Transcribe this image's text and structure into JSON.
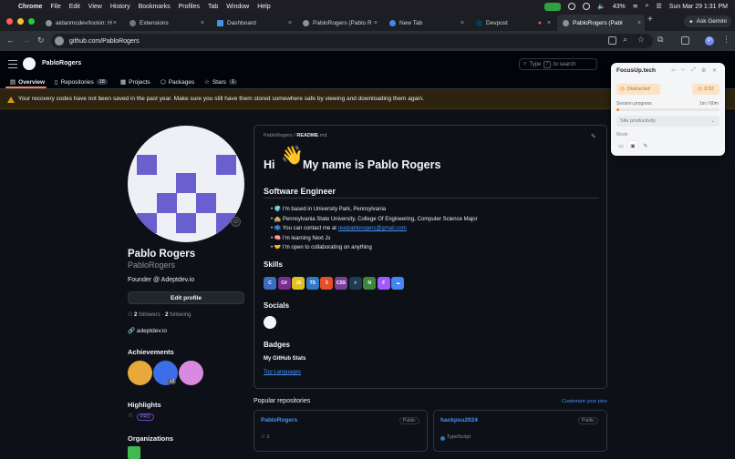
{
  "menubar": {
    "app": "Chrome",
    "items": [
      "File",
      "Edit",
      "View",
      "History",
      "Bookmarks",
      "Profiles",
      "Tab",
      "Window",
      "Help"
    ],
    "battery": "43%",
    "clock": "Sun Mar 29  1:31 PM"
  },
  "tabs": [
    {
      "label": "aidanmcdev/lockin: H"
    },
    {
      "label": "Extensions"
    },
    {
      "label": "Dashboard"
    },
    {
      "label": "PabloRogers (Pablo R"
    },
    {
      "label": "New Tab"
    },
    {
      "label": "Devpost"
    },
    {
      "label": "PabloRogers (Pabl"
    }
  ],
  "ask_gemini": "Ask Gemini",
  "address": {
    "url": "github.com/PabloRogers"
  },
  "gh": {
    "username": "PabloRogers",
    "search_text": "Type",
    "search_key": "/",
    "search_suffix": "to search",
    "nav": [
      {
        "label": "Overview"
      },
      {
        "label": "Repositories",
        "count": "18"
      },
      {
        "label": "Projects"
      },
      {
        "label": "Packages"
      },
      {
        "label": "Stars",
        "count": "1"
      }
    ]
  },
  "banner": {
    "text": "Your recovery codes have not been saved in the past year. Make sure you still have them stored somewhere safe by viewing and downloading them again."
  },
  "profile": {
    "name": "Pablo Rogers",
    "login": "PabloRogers",
    "bio": "Founder @ Adeptdev.io",
    "edit_label": "Edit profile",
    "followers": "2",
    "followers_label": "followers",
    "sep": "·",
    "following": "2",
    "following_label": "following",
    "website": "adeptdev.io",
    "achievements_label": "Achievements",
    "badge_count": "x2",
    "highlights_label": "Highlights",
    "pro_label": "PRO",
    "organizations_label": "Organizations"
  },
  "readme": {
    "path_user": "PabloRogers",
    "path_sep": " / ",
    "path_file": "README",
    "path_ext": ".md",
    "hi": "Hi",
    "heading": "My name is Pablo Rogers",
    "subheading": "Software Engineer",
    "bullets": [
      {
        "text": "🌍 I'm based in University Park, Pennsylvania"
      },
      {
        "text": "🏫 Pennsylvania State University, College Of Engineering, Computer Science Major"
      },
      {
        "text": "📫 You can contact me at ",
        "link": "realpablorogers@gmail.com"
      },
      {
        "text": "🧠 I'm learning Next Js"
      },
      {
        "text": "🤝 I'm open to collaborating on anything"
      }
    ],
    "skills_label": "Skills",
    "skills": [
      {
        "abbr": "C",
        "color": "#3b6dc0"
      },
      {
        "abbr": "C#",
        "color": "#7b2c8f"
      },
      {
        "abbr": "JS",
        "color": "#e0c21b"
      },
      {
        "abbr": "TS",
        "color": "#3178c6"
      },
      {
        "abbr": "5",
        "color": "#e34f26"
      },
      {
        "abbr": "CSS",
        "color": "#7c3f98"
      },
      {
        "abbr": "⚛",
        "color": "#1f3b4d"
      },
      {
        "abbr": "N",
        "color": "#3c873a"
      },
      {
        "abbr": "F",
        "color": "#a259ff"
      },
      {
        "abbr": "☁",
        "color": "#4285f4"
      }
    ],
    "socials_label": "Socials",
    "badges_label": "Badges",
    "stats_label": "My GitHub Stats",
    "toplang_alt": "Top Languages"
  },
  "popular": {
    "title": "Popular repositories",
    "customize": "Customize your pins",
    "repos": [
      {
        "name": "PabloRogers",
        "visibility": "Public",
        "stars": "1"
      },
      {
        "name": "hackpsu2024",
        "visibility": "Public",
        "language": "TypeScript"
      }
    ]
  },
  "focus": {
    "title": "FocusUp.tech",
    "status": "Distracted",
    "timer": "3:52",
    "session_label": "Session progress",
    "session_value": "1m / 60m",
    "session_progress": 0.02,
    "site_select": "Site productivity",
    "mode_label": "Mode"
  }
}
